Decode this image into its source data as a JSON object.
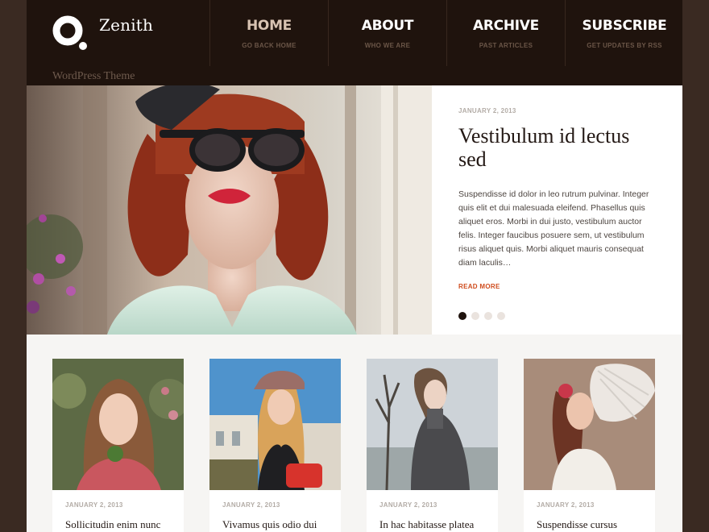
{
  "site": {
    "name": "Zenith",
    "tagline": "WordPress Theme",
    "logo_icon": "ring-dot-logo-icon"
  },
  "nav": [
    {
      "label": "HOME",
      "sub": "GO BACK HOME",
      "active": true
    },
    {
      "label": "ABOUT",
      "sub": "WHO WE ARE"
    },
    {
      "label": "ARCHIVE",
      "sub": "PAST ARTICLES"
    },
    {
      "label": "SUBSCRIBE",
      "sub": "GET UPDATES BY RSS"
    }
  ],
  "hero": {
    "date": "JANUARY 2, 2013",
    "title": "Vestibulum id lectus sed",
    "excerpt": "Suspendisse id dolor in leo rutrum pulvinar. Integer quis elit et dui malesuada eleifend. Phasellus quis aliquet eros. Morbi in dui justo, vestibulum auctor felis. Integer faucibus posuere sem, ut vestibulum risus aliquet quis. Morbi aliquet mauris consequat diam laculis…",
    "read_more": "READ MORE",
    "slide_count": 4,
    "active_slide": 1
  },
  "posts": [
    {
      "date": "JANUARY 2, 2013",
      "title": "Sollicitudin enim nunc"
    },
    {
      "date": "JANUARY 2, 2013",
      "title": "Vivamus quis odio dui"
    },
    {
      "date": "JANUARY 2, 2013",
      "title": "In hac habitasse platea"
    },
    {
      "date": "JANUARY 2, 2013",
      "title": "Suspendisse cursus"
    }
  ],
  "colors": {
    "header_bg": "#1f130d",
    "outer_bg": "#3a2a22",
    "accent": "#cf4b1c",
    "active_nav": "#d8c3b2"
  }
}
